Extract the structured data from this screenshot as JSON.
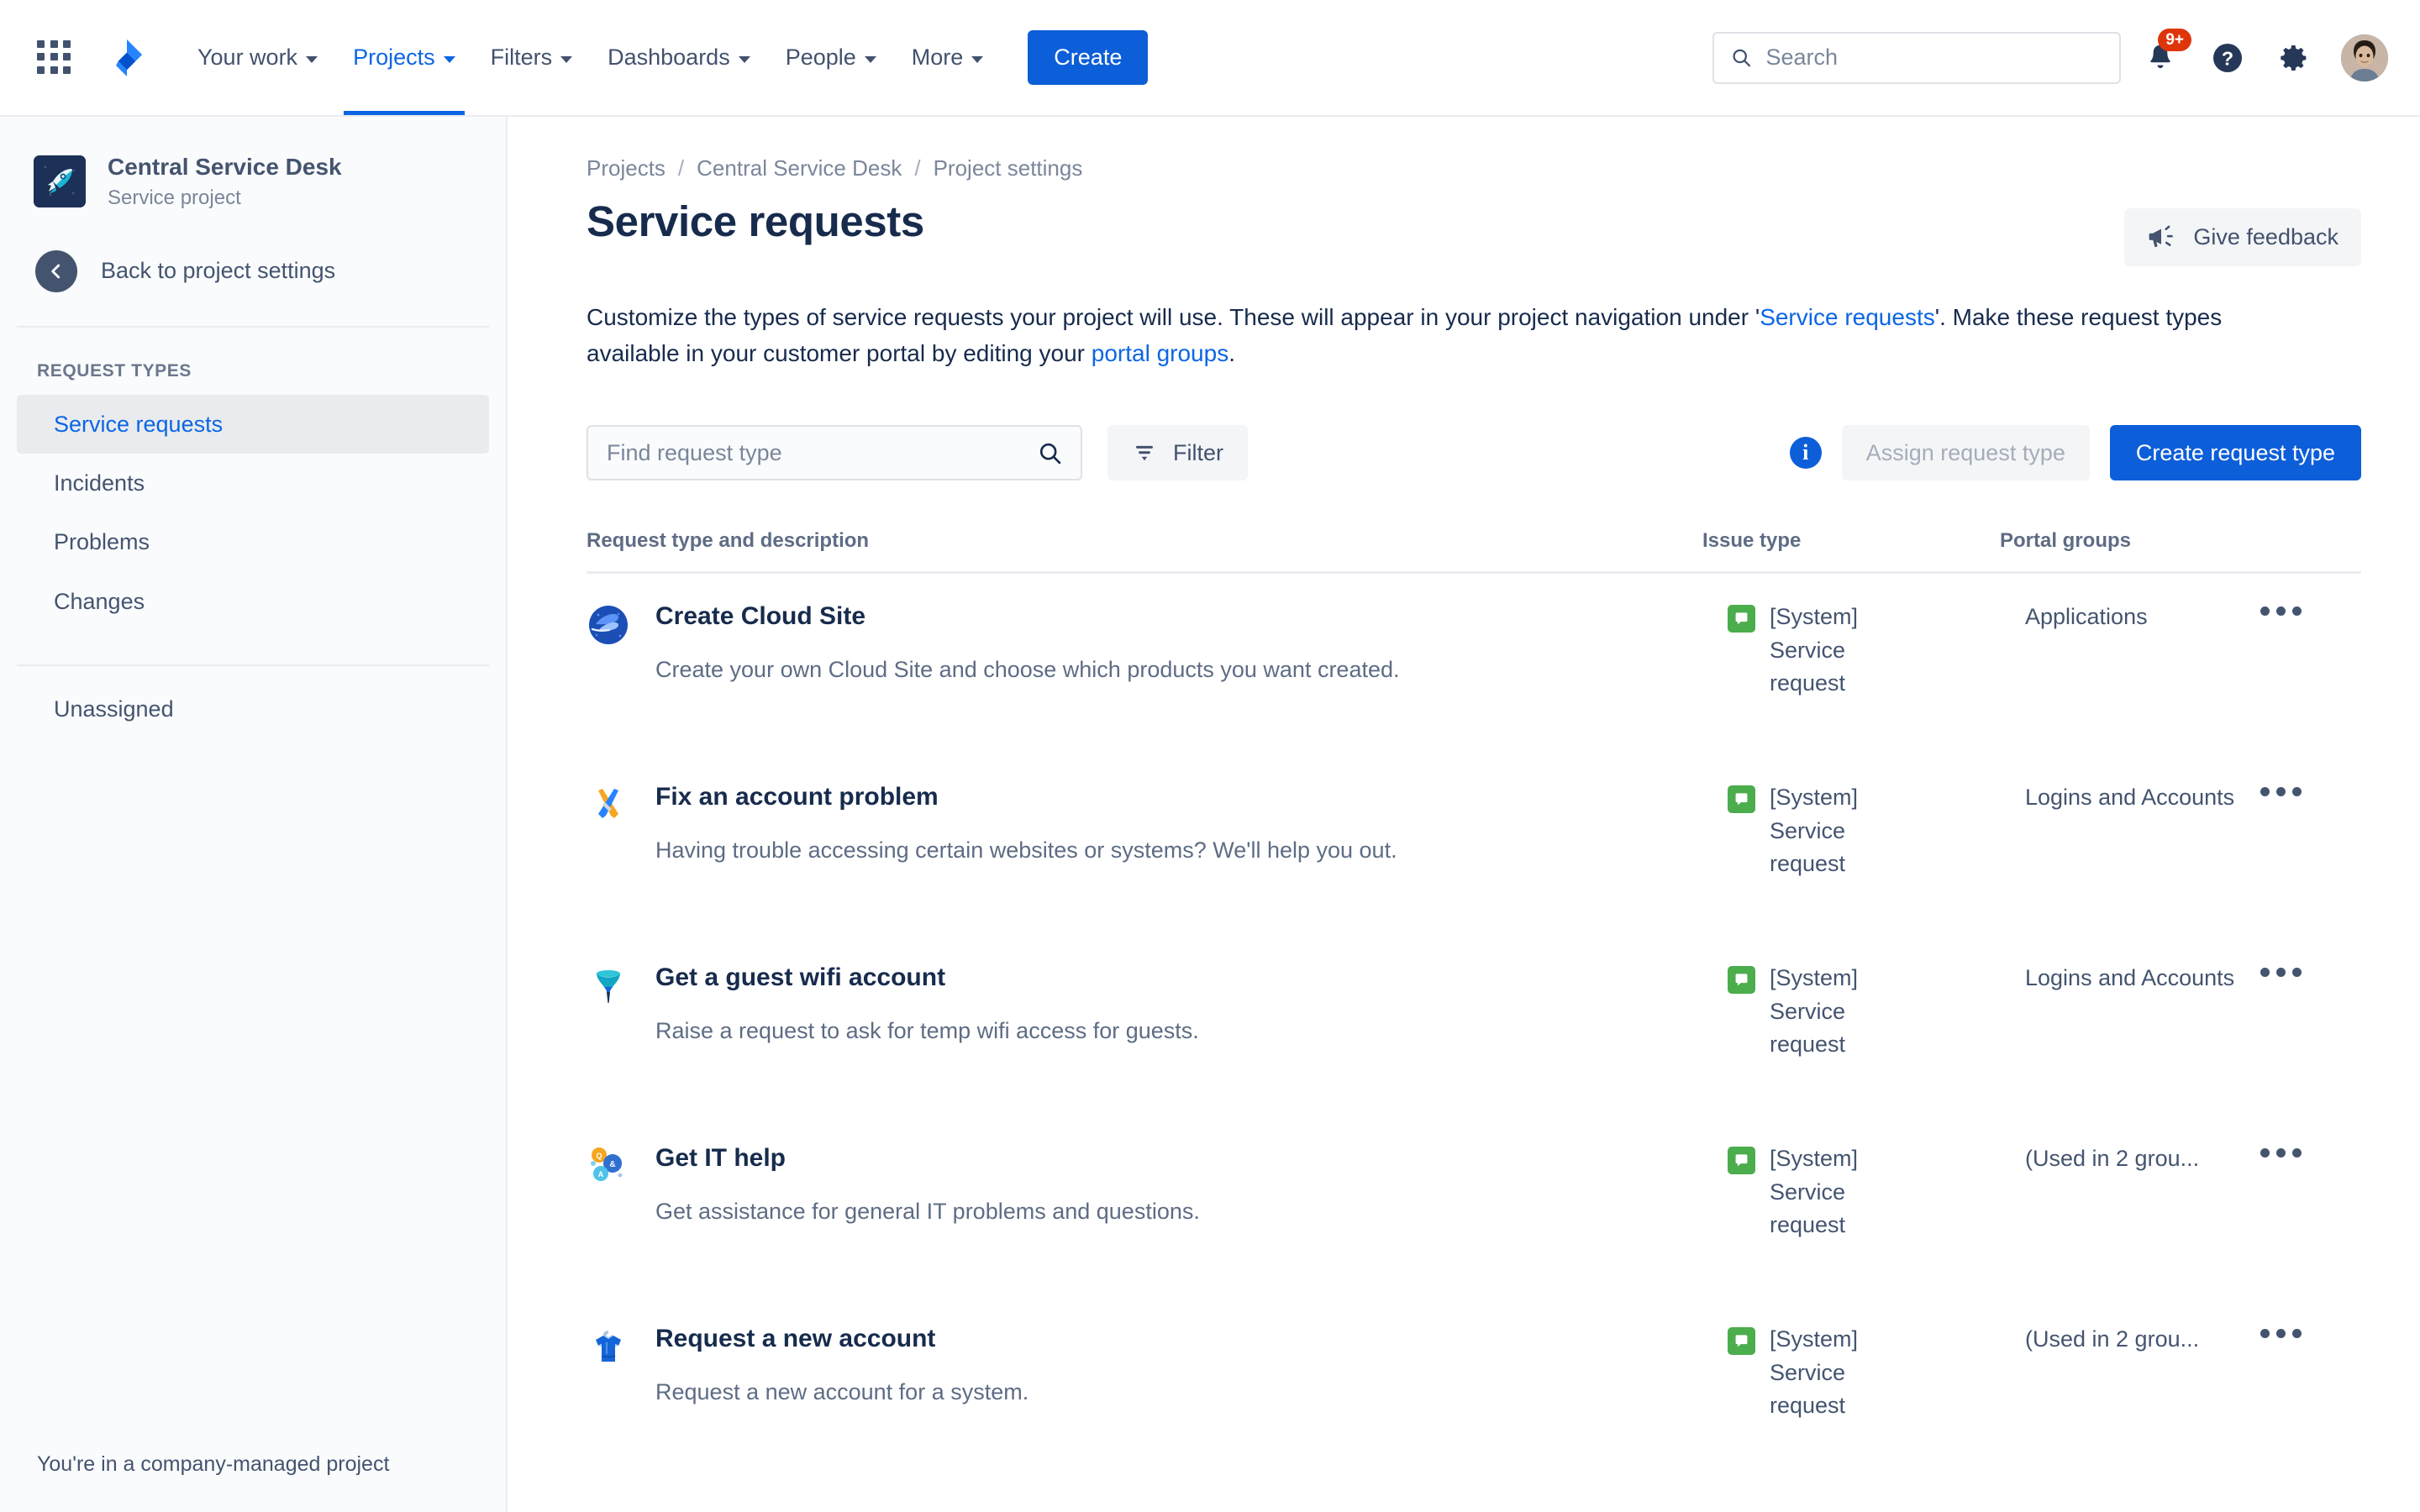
{
  "topnav": {
    "apps_icon": "apps-grid-icon",
    "logo_icon": "jira-logo-icon",
    "items": [
      {
        "label": "Your work",
        "active": false
      },
      {
        "label": "Projects",
        "active": true
      },
      {
        "label": "Filters",
        "active": false
      },
      {
        "label": "Dashboards",
        "active": false
      },
      {
        "label": "People",
        "active": false
      },
      {
        "label": "More",
        "active": false
      }
    ],
    "create_label": "Create",
    "search_placeholder": "Search",
    "search_value": "",
    "notification_badge": "9+",
    "help_icon": "help-icon",
    "settings_icon": "gear-icon",
    "avatar_icon": "user-avatar"
  },
  "sidebar": {
    "project_name": "Central Service Desk",
    "project_type": "Service project",
    "project_avatar_icon": "rocket-icon",
    "back_label": "Back to project settings",
    "section_title": "REQUEST TYPES",
    "items": [
      {
        "label": "Service requests",
        "selected": true
      },
      {
        "label": "Incidents",
        "selected": false
      },
      {
        "label": "Problems",
        "selected": false
      },
      {
        "label": "Changes",
        "selected": false
      }
    ],
    "unassigned_label": "Unassigned",
    "footer": "You're in a company-managed project"
  },
  "main": {
    "breadcrumb": [
      "Projects",
      "Central Service Desk",
      "Project settings"
    ],
    "breadcrumb_sep": "/",
    "page_title": "Service requests",
    "feedback_label": "Give feedback",
    "feedback_icon": "megaphone-icon",
    "description": {
      "part1": "Customize the types of service requests your project will use. These will appear in your project navigation under '",
      "link1": "Service requests",
      "part2": "'. Make these request types available in your customer portal by editing your ",
      "link2": "portal groups",
      "part3": "."
    },
    "toolbar": {
      "find_placeholder": "Find request type",
      "find_value": "",
      "search_icon": "search-icon",
      "filter_label": "Filter",
      "filter_icon": "filter-icon",
      "info_icon": "info-icon",
      "assign_label": "Assign request type",
      "create_label": "Create request type"
    },
    "table": {
      "headers": {
        "request": "Request type and description",
        "issue_type": "Issue type",
        "portal_groups": "Portal groups"
      },
      "accent_green": "#4bad4b",
      "rows": [
        {
          "icon": "globe-cloud-icon",
          "name": "Create Cloud Site",
          "description": "Create your own Cloud Site and choose which products you want created.",
          "issue_type": "[System] Service request",
          "portal_groups": "Applications",
          "more_icon": "more-actions-icon"
        },
        {
          "icon": "tools-icon",
          "name": "Fix an account problem",
          "description": "Having trouble accessing certain websites or systems? We'll help you out.",
          "issue_type": "[System] Service request",
          "portal_groups": "Logins and Accounts",
          "more_icon": "more-actions-icon"
        },
        {
          "icon": "funnel-icon",
          "name": "Get a guest wifi account",
          "description": "Raise a request to ask for temp wifi access for guests.",
          "issue_type": "[System] Service request",
          "portal_groups": "Logins and Accounts",
          "more_icon": "more-actions-icon"
        },
        {
          "icon": "qa-bubbles-icon",
          "name": "Get IT help",
          "description": "Get assistance for general IT problems and questions.",
          "issue_type": "[System] Service request",
          "portal_groups": "(Used in 2 grou...",
          "more_icon": "more-actions-icon"
        },
        {
          "icon": "shirt-icon",
          "name": "Request a new account",
          "description": "Request a new account for a system.",
          "issue_type": "[System] Service request",
          "portal_groups": "(Used in 2 grou...",
          "more_icon": "more-actions-icon"
        }
      ]
    }
  }
}
